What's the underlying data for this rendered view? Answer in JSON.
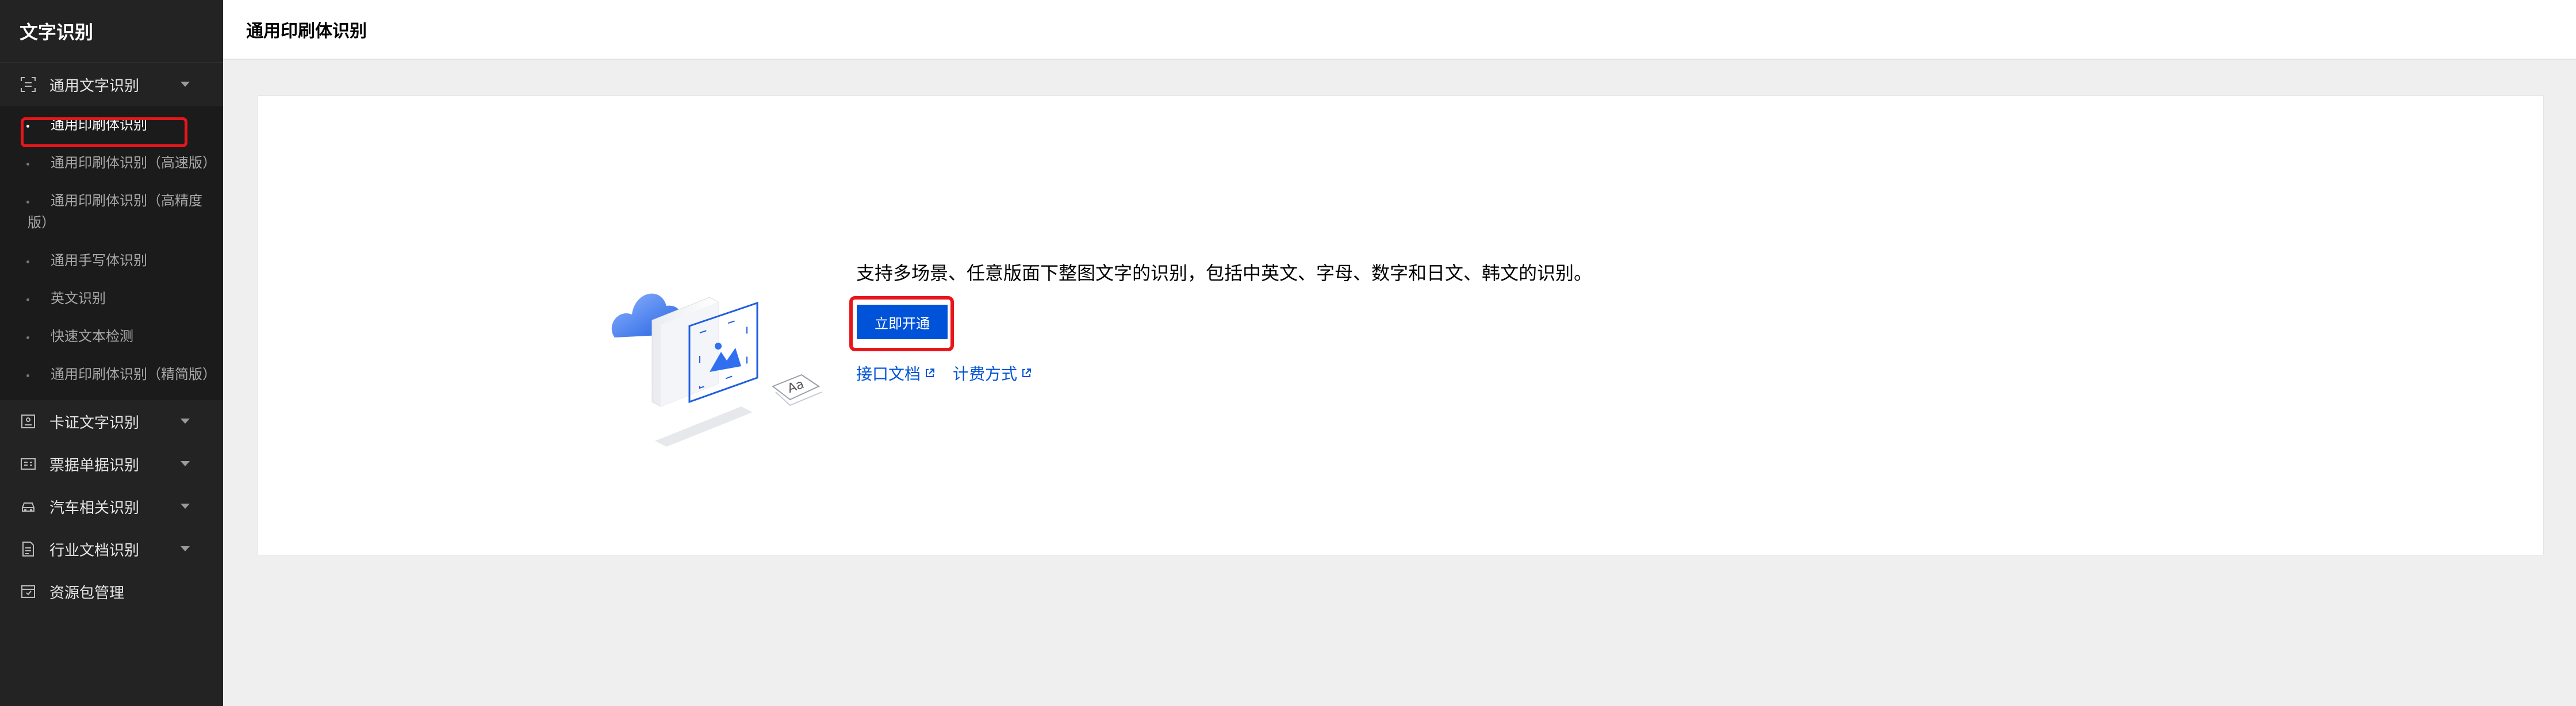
{
  "sidebar": {
    "title": "文字识别",
    "groups": [
      {
        "label": "通用文字识别",
        "icon": "scan-text-icon"
      },
      {
        "label": "卡证文字识别",
        "icon": "id-card-icon"
      },
      {
        "label": "票据单据识别",
        "icon": "receipt-icon"
      },
      {
        "label": "汽车相关识别",
        "icon": "car-icon"
      },
      {
        "label": "行业文档识别",
        "icon": "document-icon"
      },
      {
        "label": "资源包管理",
        "icon": "package-icon"
      }
    ],
    "subitems": [
      {
        "label": "通用印刷体识别"
      },
      {
        "label": "通用印刷体识别（高速版）"
      },
      {
        "label": "通用印刷体识别（高精度版）"
      },
      {
        "label": "通用手写体识别"
      },
      {
        "label": "英文识别"
      },
      {
        "label": "快速文本检测"
      },
      {
        "label": "通用印刷体识别（精简版）"
      }
    ]
  },
  "header": {
    "title": "通用印刷体识别"
  },
  "main": {
    "description": "支持多场景、任意版面下整图文字的识别，包括中英文、字母、数字和日文、韩文的识别。",
    "cta_label": "立即开通",
    "links": [
      {
        "label": "接口文档"
      },
      {
        "label": "计费方式"
      }
    ],
    "illustration_text": "Aa"
  },
  "colors": {
    "accent": "#0052d9",
    "highlight": "#e8161b",
    "sidebar_bg": "#232323"
  }
}
